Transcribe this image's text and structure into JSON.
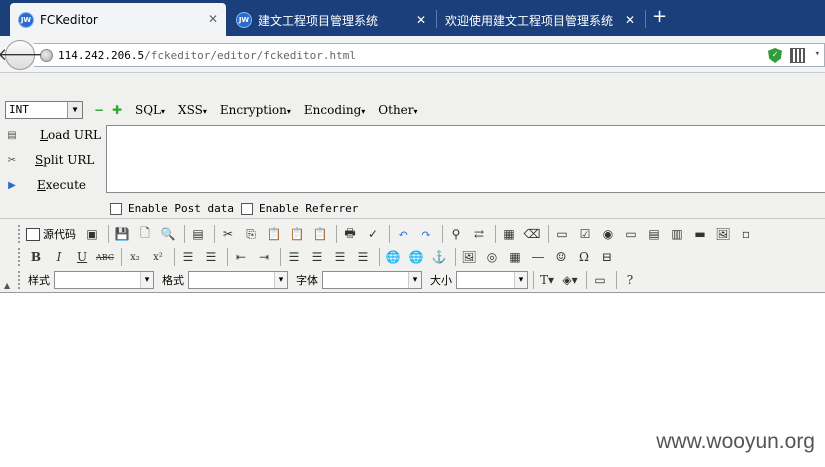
{
  "tabs": [
    {
      "icon": "JW",
      "label": "FCKeditor",
      "close": "✕"
    },
    {
      "icon": "JW",
      "label": "建文工程项目管理系统",
      "close": "✕"
    },
    {
      "label": "欢迎使用建文工程项目管理系统",
      "close": "✕"
    }
  ],
  "new_tab": "+",
  "address": {
    "host": "114.242.206.5",
    "path": "/fckeditor/editor/fckeditor.html"
  },
  "hackbar": {
    "type_select": "INT",
    "minus": "−",
    "plus": "✚",
    "menus": [
      "SQL",
      "XSS",
      "Encryption",
      "Encoding",
      "Other"
    ],
    "buttons": {
      "load": {
        "key": "L",
        "rest": "oad URL"
      },
      "split": {
        "key": "S",
        "rest": "plit URL"
      },
      "execute": {
        "key": "E",
        "rest": "xecute"
      }
    },
    "checkboxes": [
      "Enable Post data",
      "Enable Referrer"
    ]
  },
  "editor": {
    "source_label": "源代码",
    "bold": "B",
    "italic": "I",
    "underline": "U",
    "strike": "ABC",
    "subscript": "x₂",
    "superscript": "x²",
    "combos": {
      "style": "样式",
      "format": "格式",
      "font": "字体",
      "size": "大小"
    }
  },
  "watermark": "www.wooyun.org"
}
